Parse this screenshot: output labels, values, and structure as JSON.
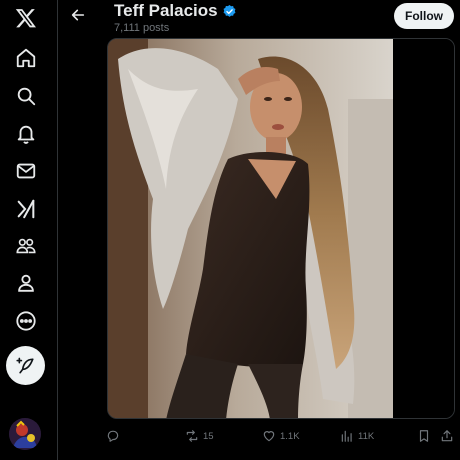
{
  "header": {
    "profile_name": "Teff Palacios",
    "post_count": "7,111 posts",
    "follow_label": "Follow"
  },
  "nav": {
    "items": [
      {
        "icon": "x-logo-icon"
      },
      {
        "icon": "home-icon"
      },
      {
        "icon": "search-icon"
      },
      {
        "icon": "bell-icon"
      },
      {
        "icon": "mail-icon"
      },
      {
        "icon": "grok-icon"
      },
      {
        "icon": "communities-icon"
      },
      {
        "icon": "person-icon"
      },
      {
        "icon": "more-circle-icon"
      }
    ],
    "post_button_icon": "feather-plus-icon"
  },
  "post": {
    "reply_count": "",
    "repost_count": "15",
    "like_count": "1.1K",
    "view_count": "11K"
  },
  "colors": {
    "background": "#000000",
    "text_primary": "#e7e9ea",
    "text_secondary": "#71767b",
    "verified_blue": "#1d9bf0",
    "follow_button_bg": "#eff3f4",
    "border": "#2f3336"
  }
}
